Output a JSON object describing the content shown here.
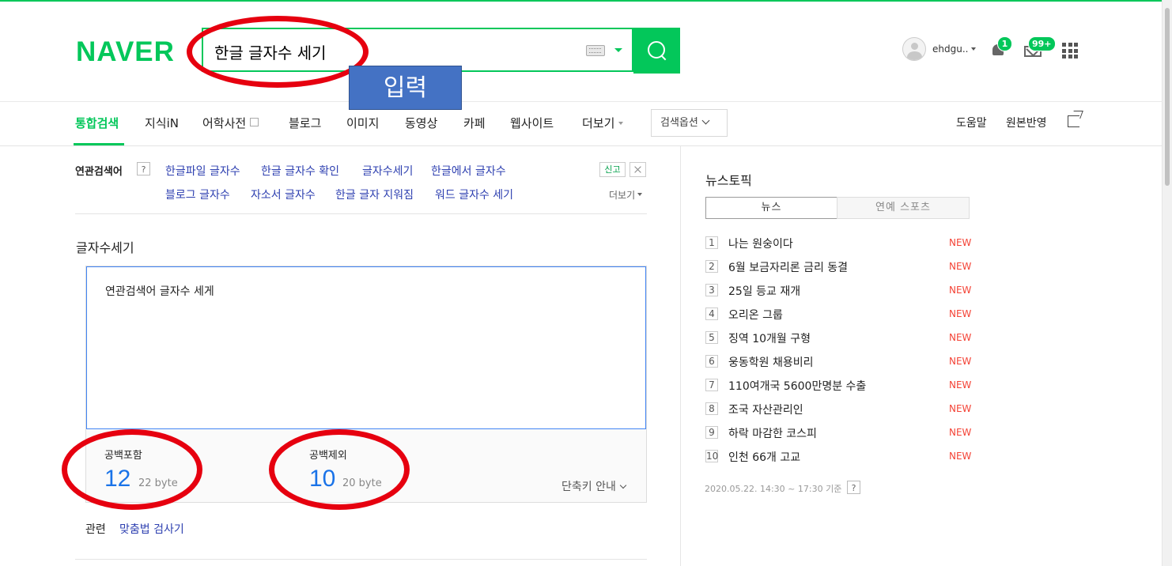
{
  "header": {
    "logo": "NAVER",
    "search_value": "한글 글자수 세기",
    "user_id": "ehdgu..",
    "notification_count": "1",
    "mail_count": "99+"
  },
  "annotation": {
    "input_callout": "입력",
    "ring_color": "#e6000f",
    "callout_color": "#4472c4"
  },
  "tabs": [
    {
      "label": "통합검색",
      "active": true
    },
    {
      "label": "지식iN"
    },
    {
      "label": "어학사전"
    },
    {
      "label": "블로그"
    },
    {
      "label": "이미지"
    },
    {
      "label": "동영상"
    },
    {
      "label": "카페"
    },
    {
      "label": "웹사이트"
    },
    {
      "label": "더보기"
    }
  ],
  "search_options": "검색옵션",
  "right_links": [
    "도움말",
    "원본반영"
  ],
  "related": {
    "label": "연관검색어",
    "help": "?",
    "row1": [
      "한글파일 글자수",
      "한글 글자수 확인",
      "글자수세기",
      "한글에서 글자수"
    ],
    "row2": [
      "블로그 글자수",
      "자소서 글자수",
      "한글 글자 지워짐",
      "워드 글자수 세기"
    ],
    "report": "신고",
    "more": "더보기"
  },
  "counter": {
    "title": "글자수세기",
    "text": "연관검색어 글자수 세게",
    "with_spaces": {
      "label": "공백포함",
      "count": "12",
      "bytes": "22 byte"
    },
    "without_spaces": {
      "label": "공백제외",
      "count": "10",
      "bytes": "20 byte"
    },
    "shortcut": "단축키 안내"
  },
  "related_tools": {
    "label": "관련",
    "link": "맞춤법 검사기"
  },
  "news": {
    "title": "뉴스토픽",
    "tabs": [
      "뉴스",
      "연예 스포츠"
    ],
    "items": [
      {
        "rank": "1",
        "title": "나는 원숭이다",
        "badge": "NEW"
      },
      {
        "rank": "2",
        "title": "6월 보금자리론 금리 동결",
        "badge": "NEW"
      },
      {
        "rank": "3",
        "title": "25일 등교 재개",
        "badge": "NEW"
      },
      {
        "rank": "4",
        "title": "오리온 그룹",
        "badge": "NEW"
      },
      {
        "rank": "5",
        "title": "징역 10개월 구형",
        "badge": "NEW"
      },
      {
        "rank": "6",
        "title": "웅동학원 채용비리",
        "badge": "NEW"
      },
      {
        "rank": "7",
        "title": "110여개국 5600만명분 수출",
        "badge": "NEW"
      },
      {
        "rank": "8",
        "title": "조국 자산관리인",
        "badge": "NEW"
      },
      {
        "rank": "9",
        "title": "하락 마감한 코스피",
        "badge": "NEW"
      },
      {
        "rank": "10",
        "title": "인천 66개 고교",
        "badge": "NEW"
      }
    ],
    "timestamp": "2020.05.22. 14:30 ~ 17:30 기준",
    "help": "?"
  },
  "colors": {
    "brand_green": "#03c75a",
    "link_blue": "#2d3fb0",
    "count_blue": "#1a73e8",
    "new_red": "#f44336"
  }
}
